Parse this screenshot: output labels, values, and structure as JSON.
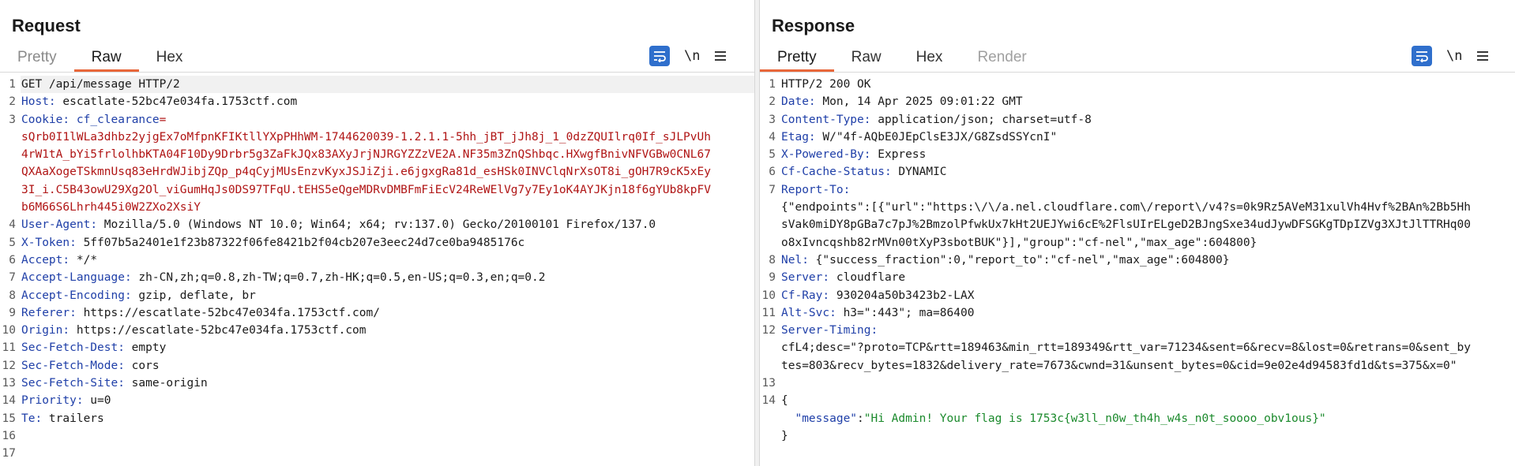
{
  "request": {
    "title": "Request",
    "tabs": [
      "Pretty",
      "Raw",
      "Hex"
    ],
    "active_tab": "Raw",
    "newline_label": "\\n",
    "lines": [
      {
        "n": "1",
        "text": "GET /api/message HTTP/2"
      },
      {
        "n": "2",
        "name": "Host",
        "value": " escatlate-52bc47e034fa.1753ctf.com"
      },
      {
        "n": "3",
        "name": "Cookie",
        "cookie_name": "cf_clearance",
        "cookie_val_first": "="
      },
      {
        "n": "",
        "cookie_val": "sQrb0I1lWLa3dhbz2yjgEx7oMfpnKFIKtllYXpPHhWM-1744620039-1.2.1.1-5hh_jBT_jJh8j_1_0dzZQUIlrq0If_sJLPvUh"
      },
      {
        "n": "",
        "cookie_val": "4rW1tA_bYi5frlolhbKTA04F10Dy9Drbr5g3ZaFkJQx83AXyJrjNJRGYZZzVE2A.NF35m3ZnQShbqc.HXwgfBnivNFVGBw0CNL67"
      },
      {
        "n": "",
        "cookie_val": "QXAaXogeTSkmnUsq83eHrdWJibjZQp_p4qCyjMUsEnzvKyxJSJiZji.e6jgxgRa81d_esHSk0INVClqNrXsOT8i_gOH7R9cK5xEy"
      },
      {
        "n": "",
        "cookie_val": "3I_i.C5B43owU29Xg2Ol_viGumHqJs0DS97TFqU.tEHS5eQgeMDRvDMBFmFiEcV24ReWElVg7y7Ey1oK4AYJKjn18f6gYUb8kpFV"
      },
      {
        "n": "",
        "cookie_val": "b6M66S6Lhrh445i0W2ZXo2XsiY"
      },
      {
        "n": "4",
        "name": "User-Agent",
        "value": " Mozilla/5.0 (Windows NT 10.0; Win64; x64; rv:137.0) Gecko/20100101 Firefox/137.0"
      },
      {
        "n": "5",
        "name": "X-Token",
        "value": " 5ff07b5a2401e1f23b87322f06fe8421b2f04cb207e3eec24d7ce0ba9485176c"
      },
      {
        "n": "6",
        "name": "Accept",
        "value": " */*"
      },
      {
        "n": "7",
        "name": "Accept-Language",
        "value": " zh-CN,zh;q=0.8,zh-TW;q=0.7,zh-HK;q=0.5,en-US;q=0.3,en;q=0.2"
      },
      {
        "n": "8",
        "name": "Accept-Encoding",
        "value": " gzip, deflate, br"
      },
      {
        "n": "9",
        "name": "Referer",
        "value": " https://escatlate-52bc47e034fa.1753ctf.com/"
      },
      {
        "n": "10",
        "name": "Origin",
        "value": " https://escatlate-52bc47e034fa.1753ctf.com"
      },
      {
        "n": "11",
        "name": "Sec-Fetch-Dest",
        "value": " empty"
      },
      {
        "n": "12",
        "name": "Sec-Fetch-Mode",
        "value": " cors"
      },
      {
        "n": "13",
        "name": "Sec-Fetch-Site",
        "value": " same-origin"
      },
      {
        "n": "14",
        "name": "Priority",
        "value": " u=0"
      },
      {
        "n": "15",
        "name": "Te",
        "value": " trailers"
      },
      {
        "n": "16",
        "text": ""
      },
      {
        "n": "17",
        "text": ""
      }
    ]
  },
  "response": {
    "title": "Response",
    "tabs": [
      "Pretty",
      "Raw",
      "Hex",
      "Render"
    ],
    "active_tab": "Pretty",
    "newline_label": "\\n",
    "lines": [
      {
        "n": "1",
        "text": "HTTP/2 200 OK"
      },
      {
        "n": "2",
        "name": "Date",
        "value": " Mon, 14 Apr 2025 09:01:22 GMT"
      },
      {
        "n": "3",
        "name": "Content-Type",
        "value": " application/json; charset=utf-8"
      },
      {
        "n": "4",
        "name": "Etag",
        "value": " W/\"4f-AQbE0JEpClsE3JX/G8ZsdSSYcnI\""
      },
      {
        "n": "5",
        "name": "X-Powered-By",
        "value": " Express"
      },
      {
        "n": "6",
        "name": "Cf-Cache-Status",
        "value": " DYNAMIC"
      },
      {
        "n": "7",
        "name": "Report-To",
        "value": ""
      },
      {
        "n": "",
        "text": "{\"endpoints\":[{\"url\":\"https:\\/\\/a.nel.cloudflare.com\\/report\\/v4?s=0k9Rz5AVeM31xulVh4Hvf%2BAn%2Bb5Hh"
      },
      {
        "n": "",
        "text": "sVak0miDY8pGBa7c7pJ%2BmzolPfwkUx7kHt2UEJYwi6cE%2FlsUIrELgeD2BJngSxe34udJywDFSGKgTDpIZVg3XJtJlTTRHq00"
      },
      {
        "n": "",
        "text": "o8xIvncqshb82rMVn00tXyP3sbotBUK\"}],\"group\":\"cf-nel\",\"max_age\":604800}"
      },
      {
        "n": "8",
        "name": "Nel",
        "value": " {\"success_fraction\":0,\"report_to\":\"cf-nel\",\"max_age\":604800}"
      },
      {
        "n": "9",
        "name": "Server",
        "value": " cloudflare"
      },
      {
        "n": "10",
        "name": "Cf-Ray",
        "value": " 930204a50b3423b2-LAX"
      },
      {
        "n": "11",
        "name": "Alt-Svc",
        "value": " h3=\":443\"; ma=86400"
      },
      {
        "n": "12",
        "name": "Server-Timing",
        "value": ""
      },
      {
        "n": "",
        "text": "cfL4;desc=\"?proto=TCP&rtt=189463&min_rtt=189349&rtt_var=71234&sent=6&recv=8&lost=0&retrans=0&sent_by"
      },
      {
        "n": "",
        "text": "tes=803&recv_bytes=1832&delivery_rate=7673&cwnd=31&unsent_bytes=0&cid=9e02e4d94583fd1d&ts=375&x=0\""
      },
      {
        "n": "13",
        "text": ""
      },
      {
        "n": "14",
        "text": "{"
      },
      {
        "n": "",
        "json_key": "  \"message\"",
        "json_sep": ":",
        "json_val": "\"Hi Admin! Your flag is 1753c{w3ll_n0w_th4h_w4s_n0t_soooo_obv1ous}\""
      },
      {
        "n": "",
        "text": "}"
      }
    ]
  }
}
